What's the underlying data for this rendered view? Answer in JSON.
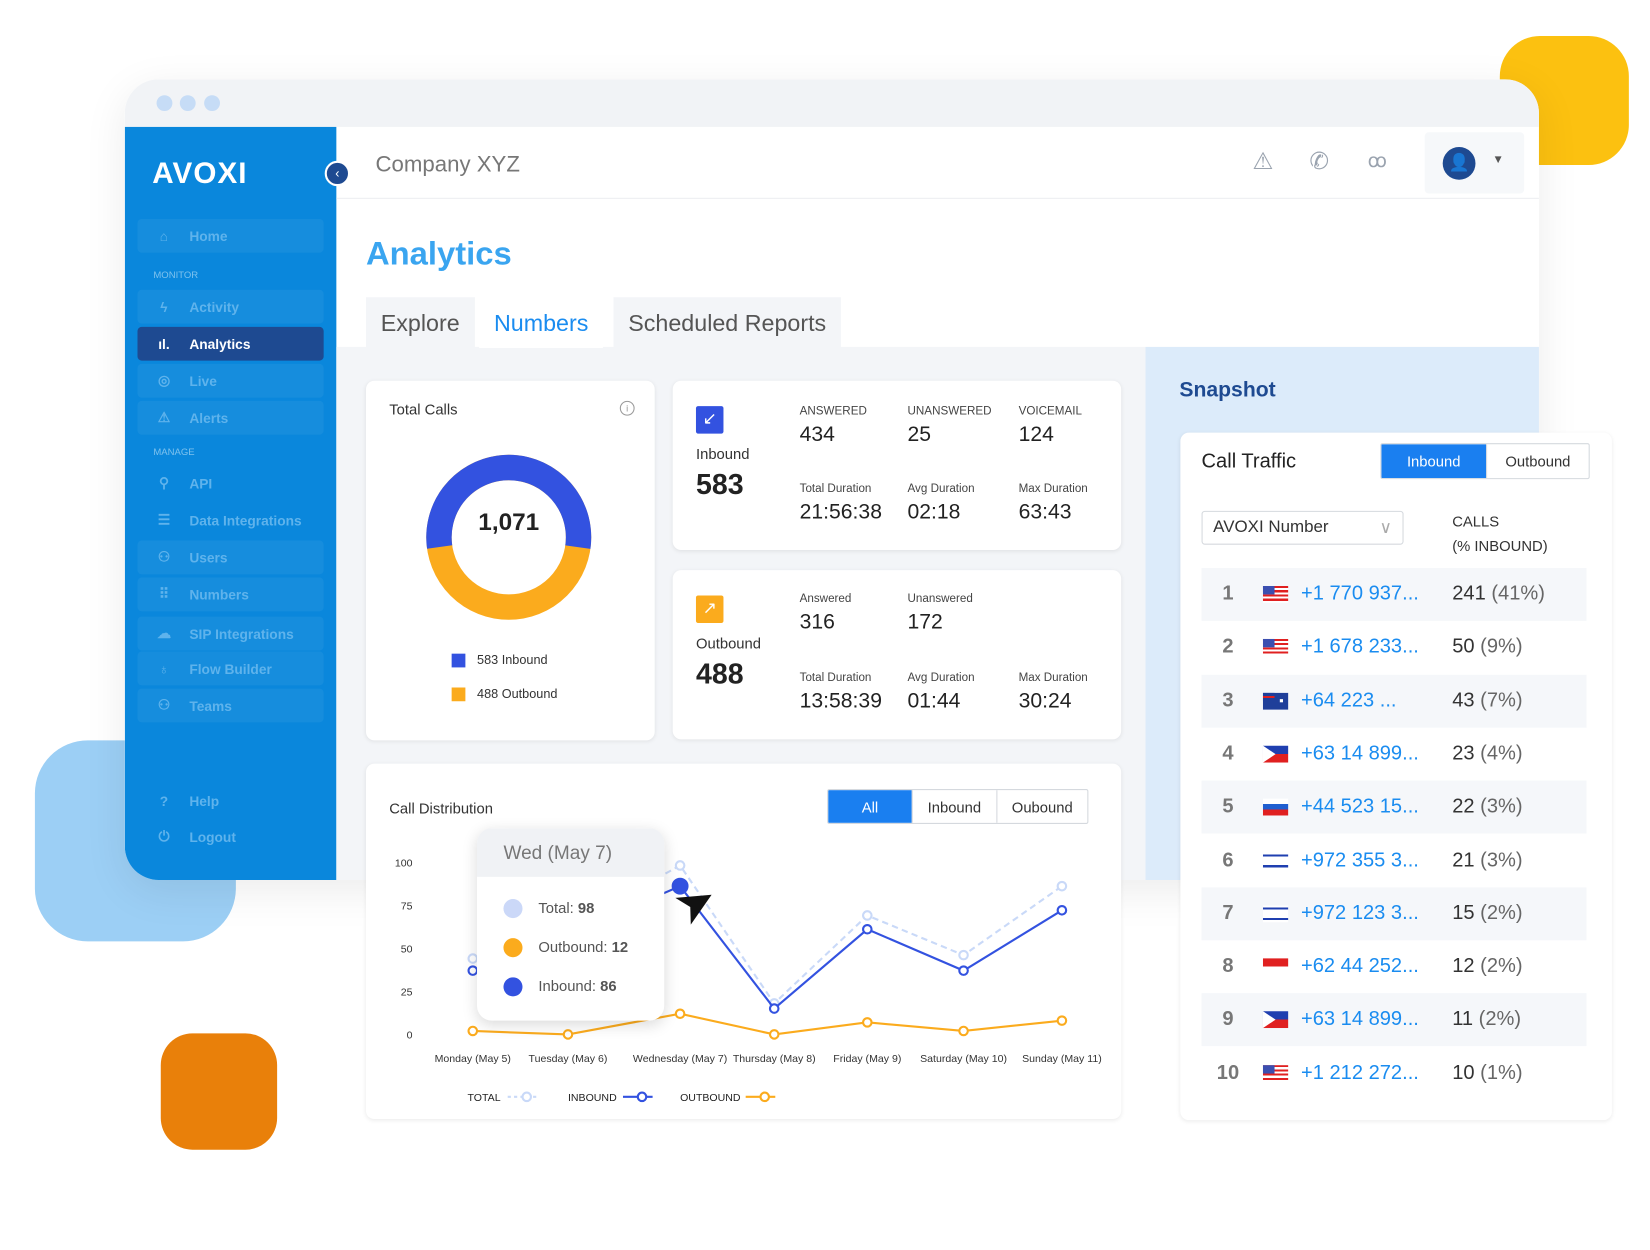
{
  "app": {
    "logo": "AVOXI",
    "company": "Company XYZ"
  },
  "sidebar": {
    "sections": [
      "MONITOR",
      "MANAGE"
    ],
    "items": [
      {
        "label": "Home",
        "icon": "home-icon"
      },
      {
        "label": "Activity",
        "icon": "bolt-icon"
      },
      {
        "label": "Analytics",
        "icon": "bar-chart-icon",
        "active": true
      },
      {
        "label": "Live",
        "icon": "live-icon"
      },
      {
        "label": "Alerts",
        "icon": "alert-icon"
      },
      {
        "label": "API",
        "icon": "plug-icon"
      },
      {
        "label": "Data Integrations",
        "icon": "database-icon"
      },
      {
        "label": "Users",
        "icon": "user-icon"
      },
      {
        "label": "Numbers",
        "icon": "keypad-icon"
      },
      {
        "label": "SIP Integrations",
        "icon": "cloud-icon"
      },
      {
        "label": "Flow Builder",
        "icon": "flow-icon"
      },
      {
        "label": "Teams",
        "icon": "teams-icon"
      }
    ],
    "footer": [
      {
        "label": "Help",
        "icon": "help-icon"
      },
      {
        "label": "Logout",
        "icon": "logout-icon"
      }
    ]
  },
  "page": {
    "title": "Analytics",
    "tabs": [
      "Explore",
      "Numbers",
      "Scheduled Reports"
    ],
    "active_tab": "Numbers"
  },
  "total_calls": {
    "title": "Total Calls",
    "total": "1,071",
    "inbound": 583,
    "outbound": 488,
    "legend": [
      "583 Inbound",
      "488 Outbound"
    ],
    "colors": {
      "inbound": "#3352e0",
      "outbound": "#fbab1d"
    }
  },
  "inbound": {
    "label": "Inbound",
    "total": "583",
    "stats": [
      {
        "label": "ANSWERED",
        "value": "434"
      },
      {
        "label": "UNANSWERED",
        "value": "25"
      },
      {
        "label": "VOICEMAIL",
        "value": "124"
      },
      {
        "label": "Total Duration",
        "value": "21:56:38"
      },
      {
        "label": "Avg Duration",
        "value": "02:18"
      },
      {
        "label": "Max Duration",
        "value": "63:43"
      }
    ]
  },
  "outbound": {
    "label": "Outbound",
    "total": "488",
    "stats": [
      {
        "label": "Answered",
        "value": "316"
      },
      {
        "label": "Unanswered",
        "value": "172"
      },
      {
        "label": "Total Duration",
        "value": "13:58:39"
      },
      {
        "label": "Avg Duration",
        "value": "01:44"
      },
      {
        "label": "Max Duration",
        "value": "30:24"
      }
    ]
  },
  "distribution": {
    "title": "Call Distribution",
    "filters": [
      "All",
      "Inbound",
      "Oubound"
    ],
    "active_filter": "All",
    "tooltip": {
      "title": "Wed (May 7)",
      "items": [
        {
          "label": "Total: ",
          "value": "98"
        },
        {
          "label": "Outbound: ",
          "value": "12"
        },
        {
          "label": "Inbound: ",
          "value": "86"
        }
      ]
    }
  },
  "chart_data": {
    "type": "line",
    "categories": [
      "Monday (May 5)",
      "Tuesday (May 6)",
      "Wednesday (May 7)",
      "Thursday (May 8)",
      "Friday (May 9)",
      "Saturday (May 10)",
      "Sunday (May 11)"
    ],
    "yticks": [
      "0",
      "25",
      "50",
      "75",
      "100"
    ],
    "ylim": [
      0,
      100
    ],
    "series": [
      {
        "name": "TOTAL",
        "values": [
          44,
          62,
          98,
          18,
          69,
          46,
          86
        ],
        "color": "#c9d9f8",
        "dashed": true
      },
      {
        "name": "INBOUND",
        "values": [
          37,
          58,
          86,
          15,
          61,
          37,
          72
        ],
        "color": "#3352e0"
      },
      {
        "name": "OUTBOUND",
        "values": [
          2,
          0,
          12,
          0,
          7,
          2,
          8
        ],
        "color": "#fbab1d"
      }
    ],
    "legend": "bottom"
  },
  "snapshot": {
    "title": "Snapshot",
    "card_title": "Call Traffic",
    "toggle": [
      "Inbound",
      "Outbound"
    ],
    "active": "Inbound",
    "select": "AVOXI Number",
    "col_header": [
      "CALLS",
      "(% INBOUND)"
    ],
    "rows": [
      {
        "rank": "1",
        "flag": "us",
        "number": "+1 770 937...",
        "calls": "241",
        "pct": "(41%)"
      },
      {
        "rank": "2",
        "flag": "us",
        "number": "+1 678 233...",
        "calls": "50",
        "pct": "(9%)"
      },
      {
        "rank": "3",
        "flag": "au",
        "number": "+64 223 ...",
        "calls": "43",
        "pct": "(7%)"
      },
      {
        "rank": "4",
        "flag": "ph",
        "number": "+63 14 899...",
        "calls": "23",
        "pct": "(4%)"
      },
      {
        "rank": "5",
        "flag": "si",
        "number": "+44 523 15...",
        "calls": "22",
        "pct": "(3%)"
      },
      {
        "rank": "6",
        "flag": "il",
        "number": "+972 355 3...",
        "calls": "21",
        "pct": "(3%)"
      },
      {
        "rank": "7",
        "flag": "il",
        "number": "+972 123 3...",
        "calls": "15",
        "pct": "(2%)"
      },
      {
        "rank": "8",
        "flag": "id",
        "number": "+62 44 252...",
        "calls": "12",
        "pct": "(2%)"
      },
      {
        "rank": "9",
        "flag": "ph",
        "number": "+63 14 899...",
        "calls": "11",
        "pct": "(2%)"
      },
      {
        "rank": "10",
        "flag": "us",
        "number": "+1 212 272...",
        "calls": "10",
        "pct": "(1%)"
      }
    ]
  }
}
